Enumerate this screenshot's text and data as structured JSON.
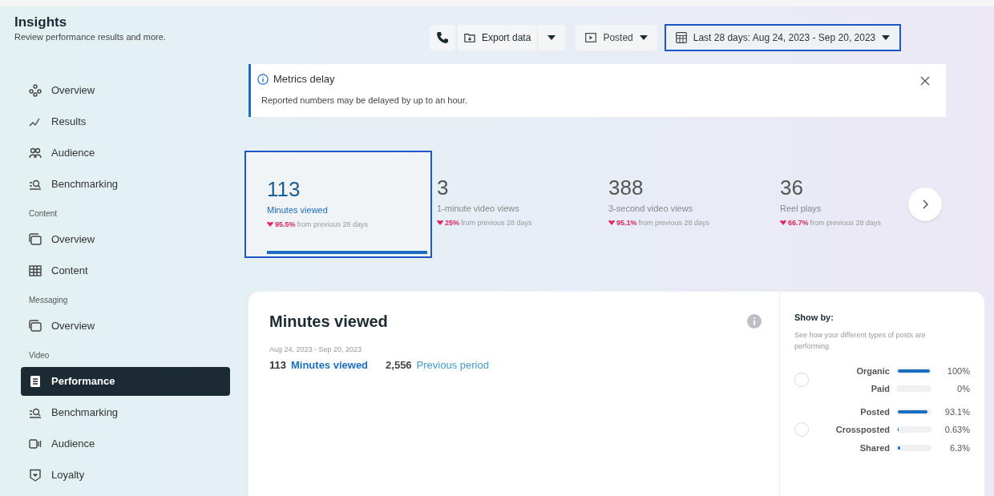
{
  "header": {
    "title": "Insights",
    "subtitle": "Review performance results and more."
  },
  "toolbar": {
    "export_label": "Export data",
    "posted_label": "Posted",
    "date_range": {
      "label": "Last 28 days: Aug 24, 2023 - Sep 20, 2023",
      "selected": true
    }
  },
  "sidebar": {
    "sections": [
      {
        "items": [
          {
            "label": "Overview",
            "selected": false
          },
          {
            "label": "Results",
            "selected": false
          },
          {
            "label": "Audience",
            "selected": false
          },
          {
            "label": "Benchmarking",
            "selected": false
          }
        ]
      },
      {
        "heading": "Content",
        "items": [
          {
            "label": "Overview",
            "selected": false
          },
          {
            "label": "Content",
            "selected": false
          }
        ]
      },
      {
        "heading": "Messaging",
        "items": [
          {
            "label": "Overview",
            "selected": false
          }
        ]
      },
      {
        "heading": "Video",
        "items": [
          {
            "label": "Performance",
            "selected": true
          },
          {
            "label": "Benchmarking",
            "selected": false
          },
          {
            "label": "Audience",
            "selected": false
          },
          {
            "label": "Loyalty",
            "selected": false
          }
        ]
      }
    ]
  },
  "notice": {
    "title": "Metrics delay",
    "message": "Reported numbers may be delayed by up to an hour."
  },
  "metrics": [
    {
      "value": "113",
      "label": "Minutes viewed",
      "change": "95.5%",
      "suffix": "from previous 28 days",
      "selected": true
    },
    {
      "value": "3",
      "label": "1-minute video views",
      "change": "25%",
      "suffix": "from previous 28 days",
      "selected": false
    },
    {
      "value": "388",
      "label": "3-second video views",
      "change": "95.1%",
      "suffix": "from previous 28 days",
      "selected": false
    },
    {
      "value": "36",
      "label": "Reel plays",
      "change": "66.7%",
      "suffix": "from previous 28 days",
      "selected": false
    }
  ],
  "chart_card": {
    "title": "Minutes viewed",
    "date_range": "Aug 24, 2023 - Sep 20, 2023",
    "current_value": "113",
    "current_label": "Minutes viewed",
    "previous_value": "2,556",
    "previous_label": "Previous period"
  },
  "show_by": {
    "title": "Show by:",
    "description": "See how your different types of posts are performing",
    "groups": [
      {
        "selected": false,
        "rows": [
          {
            "label": "Organic",
            "level": 1,
            "reading": "100%"
          },
          {
            "label": "Paid",
            "reading": "0%"
          }
        ]
      },
      {
        "selected": false,
        "rows": [
          {
            "label": "Posted",
            "level": 0.931,
            "reading": "93.1%"
          },
          {
            "label": "Crossposted",
            "level": 0.0063,
            "reading": "0.63%"
          },
          {
            "label": "Shared",
            "level": 0.063,
            "reading": "6.3%"
          }
        ]
      }
    ]
  }
}
